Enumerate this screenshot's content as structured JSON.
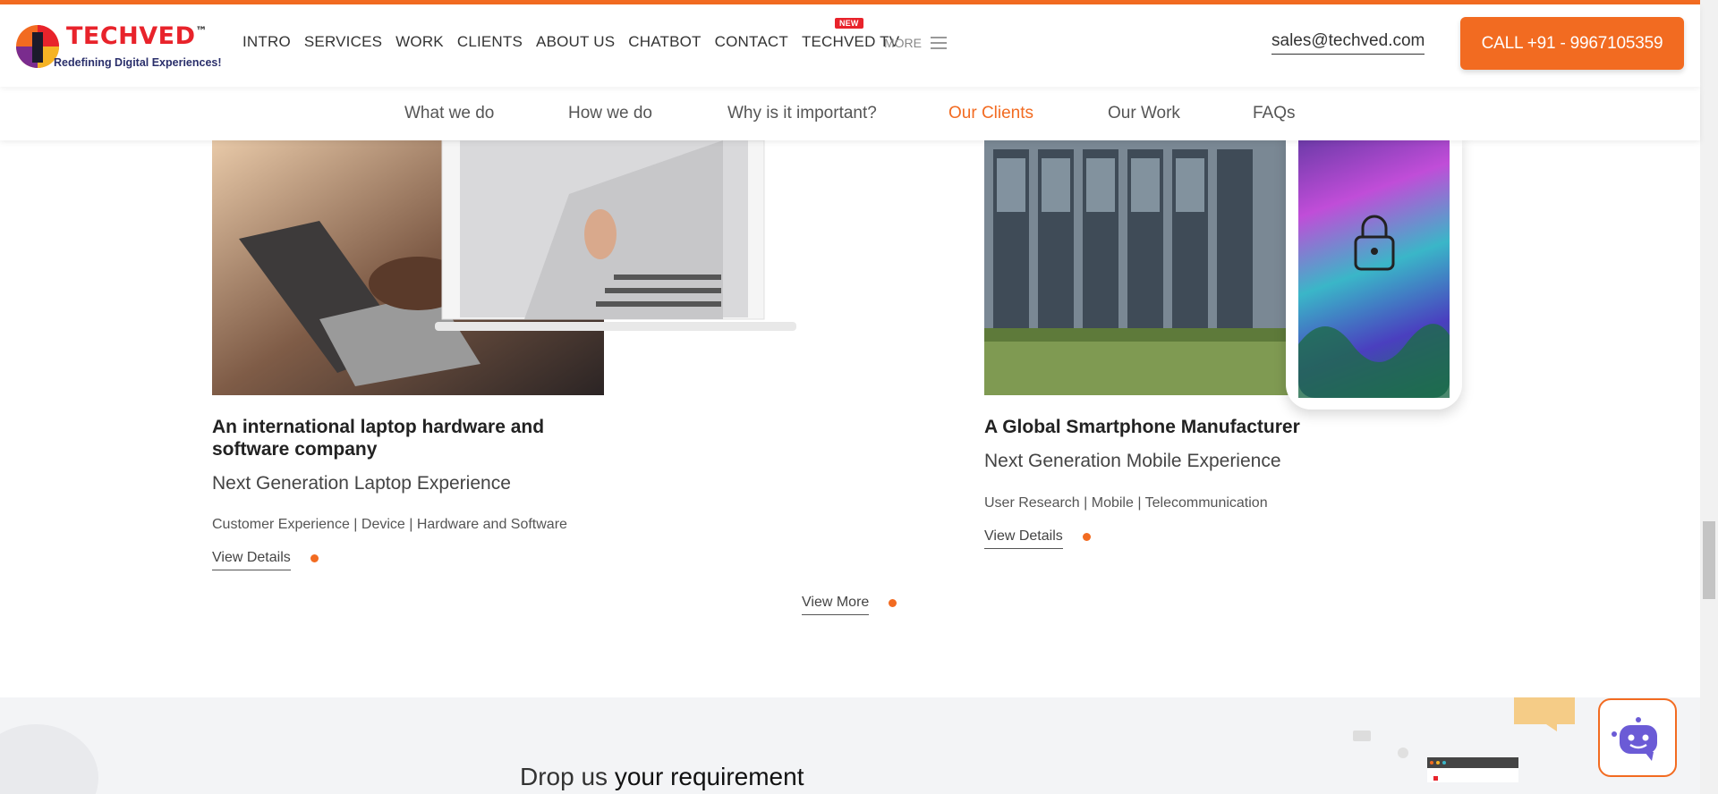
{
  "header": {
    "logo_text": "TECHVED",
    "logo_tm": "™",
    "logo_tagline": "Redefining Digital Experiences!",
    "nav": [
      {
        "label": "INTRO"
      },
      {
        "label": "SERVICES"
      },
      {
        "label": "WORK"
      },
      {
        "label": "CLIENTS"
      },
      {
        "label": "ABOUT US"
      },
      {
        "label": "CHATBOT"
      },
      {
        "label": "CONTACT"
      },
      {
        "label": "TECHVED TV",
        "badge": "NEW"
      }
    ],
    "more_label": "MORE",
    "email": "sales@techved.com",
    "call_label": "CALL +91 - 9967105359"
  },
  "subnav": {
    "items": [
      {
        "label": "What we do"
      },
      {
        "label": "How we do"
      },
      {
        "label": "Why is it important?"
      },
      {
        "label": "Our Clients",
        "active": true
      },
      {
        "label": "Our Work"
      },
      {
        "label": "FAQs"
      }
    ]
  },
  "clients": [
    {
      "title": "An international laptop hardware and software company",
      "subtitle": "Next Generation Laptop Experience",
      "tags": "Customer Experience | Device | Hardware and Software",
      "link": "View Details"
    },
    {
      "title": "A Global Smartphone Manufacturer",
      "subtitle": "Next Generation Mobile Experience",
      "tags": "User Research | Mobile | Telecommunication",
      "link": "View Details"
    }
  ],
  "view_more": "View More",
  "drop_requirement": {
    "prefix": "Drop us",
    "suffix": "your requirement"
  },
  "colors": {
    "accent": "#f26b21",
    "brand_red": "#e8232b"
  }
}
